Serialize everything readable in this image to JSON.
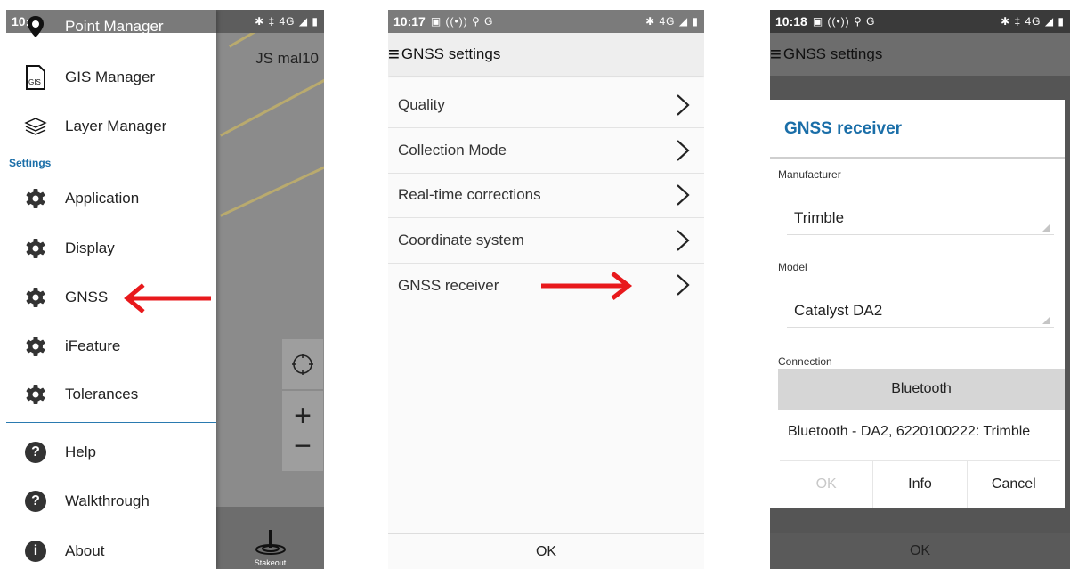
{
  "panel1": {
    "status_time": "10:",
    "status_right": "✱ ‡ 4G ◢ ▮",
    "map_title": "JS mal10",
    "stakeout_label": "Stakeout",
    "settings_header": "Settings",
    "items": [
      {
        "label": "Point Manager",
        "icon": "map-pin-icon"
      },
      {
        "label": "GIS Manager",
        "icon": "gis-file-icon"
      },
      {
        "label": "Layer Manager",
        "icon": "layers-icon"
      },
      {
        "label": "Application",
        "icon": "gear-icon"
      },
      {
        "label": "Display",
        "icon": "gear-icon"
      },
      {
        "label": "GNSS",
        "icon": "gear-icon"
      },
      {
        "label": "iFeature",
        "icon": "gear-icon"
      },
      {
        "label": "Tolerances",
        "icon": "gear-icon"
      },
      {
        "label": "Help",
        "icon": "help-icon"
      },
      {
        "label": "Walkthrough",
        "icon": "help-icon"
      },
      {
        "label": "About",
        "icon": "info-icon"
      }
    ],
    "zoom_in": "+",
    "zoom_out": "−",
    "arrow_color": "#e8191c"
  },
  "panel2": {
    "status_time": "10:17",
    "status_notif": "▣ ((•)) ⚲ G",
    "status_right": "✱ 4G ◢ ▮",
    "title": "GNSS settings",
    "rows": [
      "Quality",
      "Collection Mode",
      "Real-time corrections",
      "Coordinate system",
      "GNSS receiver"
    ],
    "ok_label": "OK"
  },
  "panel3": {
    "status_time": "10:18",
    "status_notif": "▣ ((•)) ⚲ G",
    "status_right": "✱ ‡ 4G ◢ ▮",
    "title": "GNSS settings",
    "ok_label": "OK",
    "dialog": {
      "title": "GNSS receiver",
      "manufacturer_label": "Manufacturer",
      "manufacturer_value": "Trimble",
      "model_label": "Model",
      "model_value": "Catalyst DA2",
      "connection_label": "Connection",
      "connection_button": "Bluetooth",
      "connection_value": "Bluetooth - DA2, 6220100222: Trimble",
      "ok": "OK",
      "info": "Info",
      "cancel": "Cancel",
      "title_color": "#1a6ea8"
    }
  }
}
